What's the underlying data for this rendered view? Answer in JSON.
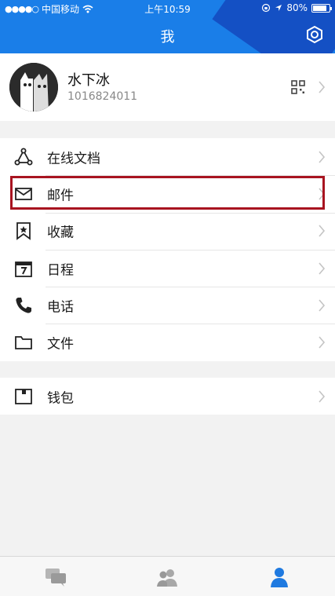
{
  "status": {
    "carrier": "中国移动",
    "time": "上午10:59",
    "battery": "80%"
  },
  "header": {
    "title": "我"
  },
  "profile": {
    "name": "水下冰",
    "id": "1016824011"
  },
  "menu": [
    {
      "label": "在线文档",
      "icon": "share-nodes-icon"
    },
    {
      "label": "邮件",
      "icon": "mail-icon"
    },
    {
      "label": "收藏",
      "icon": "bookmark-icon"
    },
    {
      "label": "日程",
      "icon": "calendar-icon"
    },
    {
      "label": "电话",
      "icon": "phone-icon"
    },
    {
      "label": "文件",
      "icon": "folder-icon"
    }
  ],
  "menu2": [
    {
      "label": "钱包",
      "icon": "wallet-icon"
    }
  ],
  "tabs": [
    "chat-tab",
    "contacts-tab",
    "me-tab"
  ],
  "colors": {
    "header": "#1a7ee8",
    "highlight": "#a81420",
    "active_tab": "#1f7ae0"
  }
}
